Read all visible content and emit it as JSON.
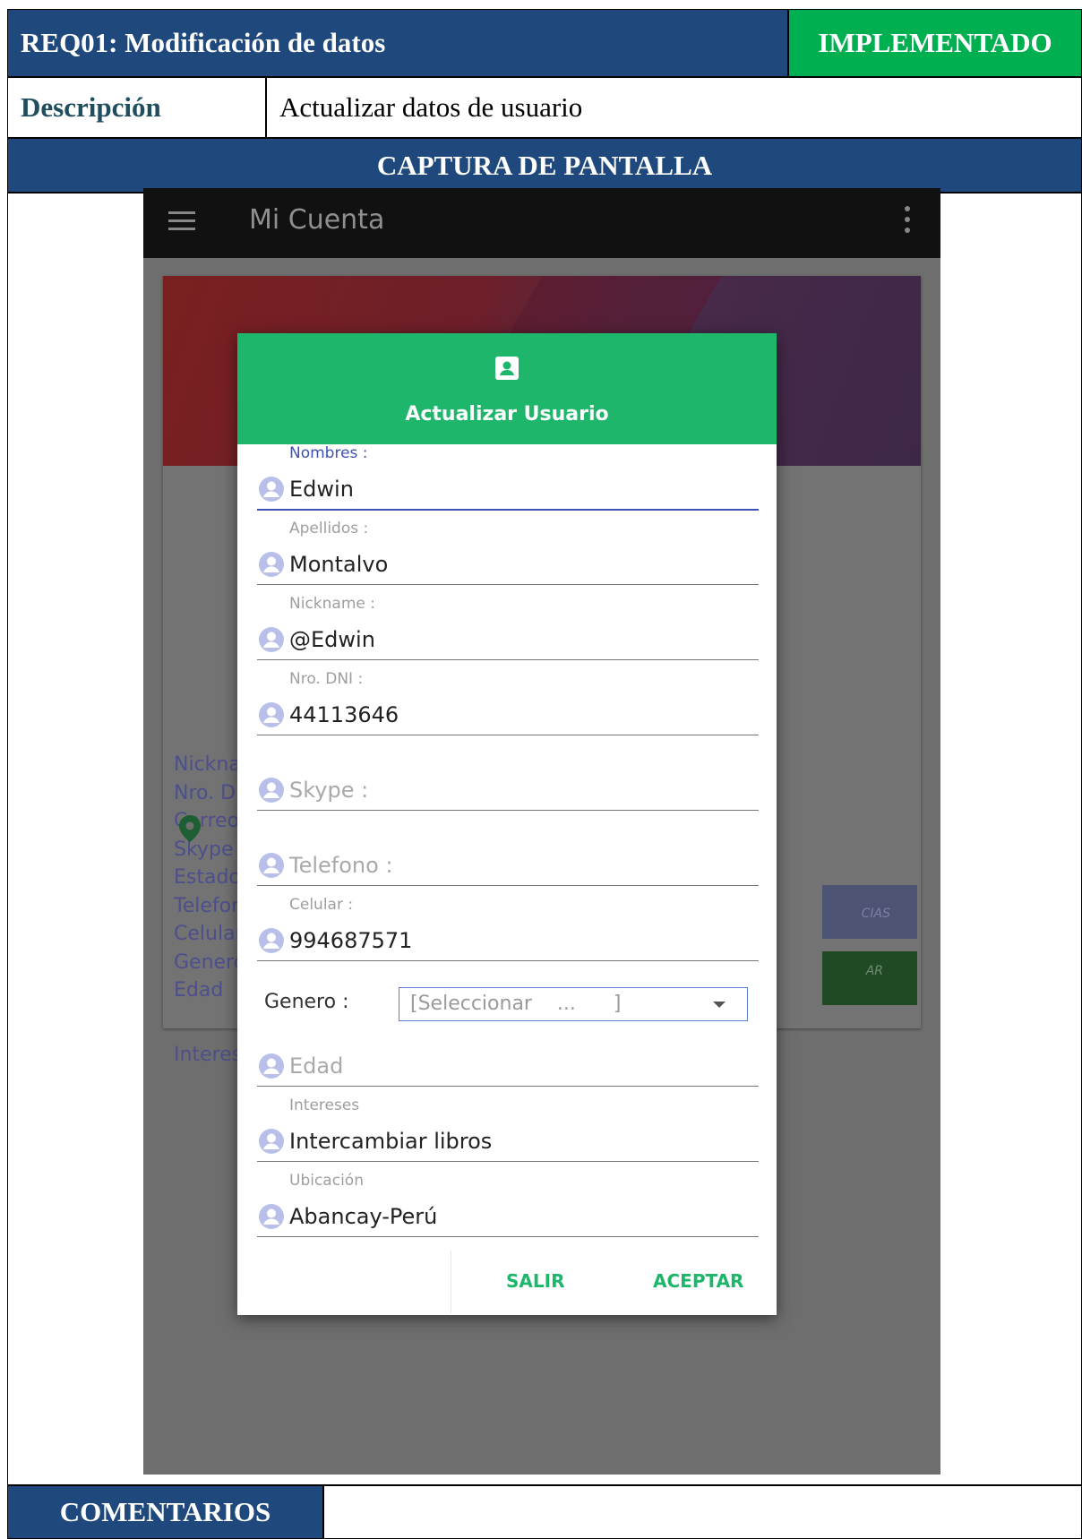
{
  "document": {
    "req_title": "REQ01: Modificación de datos",
    "status": "IMPLEMENTADO",
    "description_label": "Descripción",
    "description_value": "Actualizar datos de usuario",
    "capture_header": "CAPTURA DE PANTALLA",
    "comments_header": "COMENTARIOS",
    "colors": {
      "header_blue": "#1f497d",
      "status_green": "#00b050"
    }
  },
  "app": {
    "title": "Mi Cuenta",
    "icons": [
      "menu-icon",
      "overflow-menu-icon"
    ],
    "background_labels": [
      "Nicknar",
      "Nro. DN",
      "Correo :",
      "Skype :",
      "Estado",
      "Telefon",
      "Celular :",
      "Genero",
      "Edad",
      "Interese"
    ],
    "background_buttons": [
      "CIAS",
      "AR"
    ]
  },
  "dialog": {
    "title": "Actualizar Usuario",
    "accent": "#1db66a",
    "fields": [
      {
        "label": "Nombres :",
        "value": "Edwin"
      },
      {
        "label": "Apellidos :",
        "value": "Montalvo"
      },
      {
        "label": "Nickname :",
        "value": "@Edwin"
      },
      {
        "label": "Nro. DNI :",
        "value": "44113646"
      },
      {
        "placeholder": "Skype :"
      },
      {
        "placeholder": "Telefono :"
      },
      {
        "label": "Celular :",
        "value": "994687571"
      }
    ],
    "genero": {
      "label": "Genero :",
      "select_value": "[Seleccionar    ...      ]"
    },
    "fields_after": [
      {
        "placeholder": "Edad"
      },
      {
        "label": "Intereses",
        "value": "Intercambiar libros"
      },
      {
        "label": "Ubicación",
        "value": "Abancay-Perú"
      }
    ],
    "buttons": {
      "exit": "SALIR",
      "accept": "ACEPTAR"
    }
  }
}
